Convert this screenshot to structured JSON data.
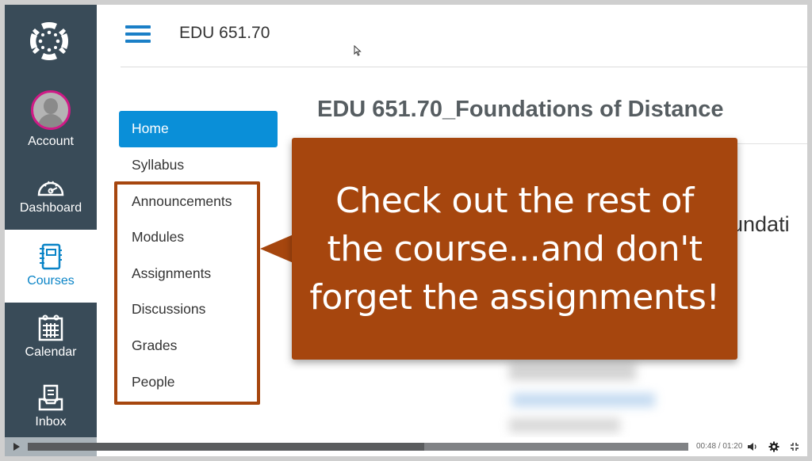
{
  "global_nav": {
    "items": [
      {
        "label": "Account",
        "icon": "avatar-icon"
      },
      {
        "label": "Dashboard",
        "icon": "dashboard-icon"
      },
      {
        "label": "Courses",
        "icon": "courses-icon",
        "active": true
      },
      {
        "label": "Calendar",
        "icon": "calendar-icon"
      },
      {
        "label": "Inbox",
        "icon": "inbox-icon"
      }
    ]
  },
  "header": {
    "course_code": "EDU 651.70"
  },
  "course_nav": {
    "items": [
      {
        "label": "Home",
        "active": true
      },
      {
        "label": "Syllabus"
      },
      {
        "label": "Announcements"
      },
      {
        "label": "Modules"
      },
      {
        "label": "Assignments"
      },
      {
        "label": "Discussions"
      },
      {
        "label": "Grades"
      },
      {
        "label": "People"
      }
    ]
  },
  "main": {
    "course_title": "EDU 651.70_Foundations of Distance",
    "partial_heading": "undati"
  },
  "callout": {
    "lines": [
      "Check out the rest of",
      "the course...and don't",
      "forget the assignments!"
    ]
  },
  "video": {
    "current_time": "00:48",
    "duration": "01:20",
    "time_display": "00:48 / 01:20",
    "progress_fraction": 0.6
  },
  "colors": {
    "nav_bg": "#394b58",
    "accent_blue": "#0a8fd8",
    "callout_bg": "#a6460e",
    "avatar_ring": "#d01a86"
  }
}
